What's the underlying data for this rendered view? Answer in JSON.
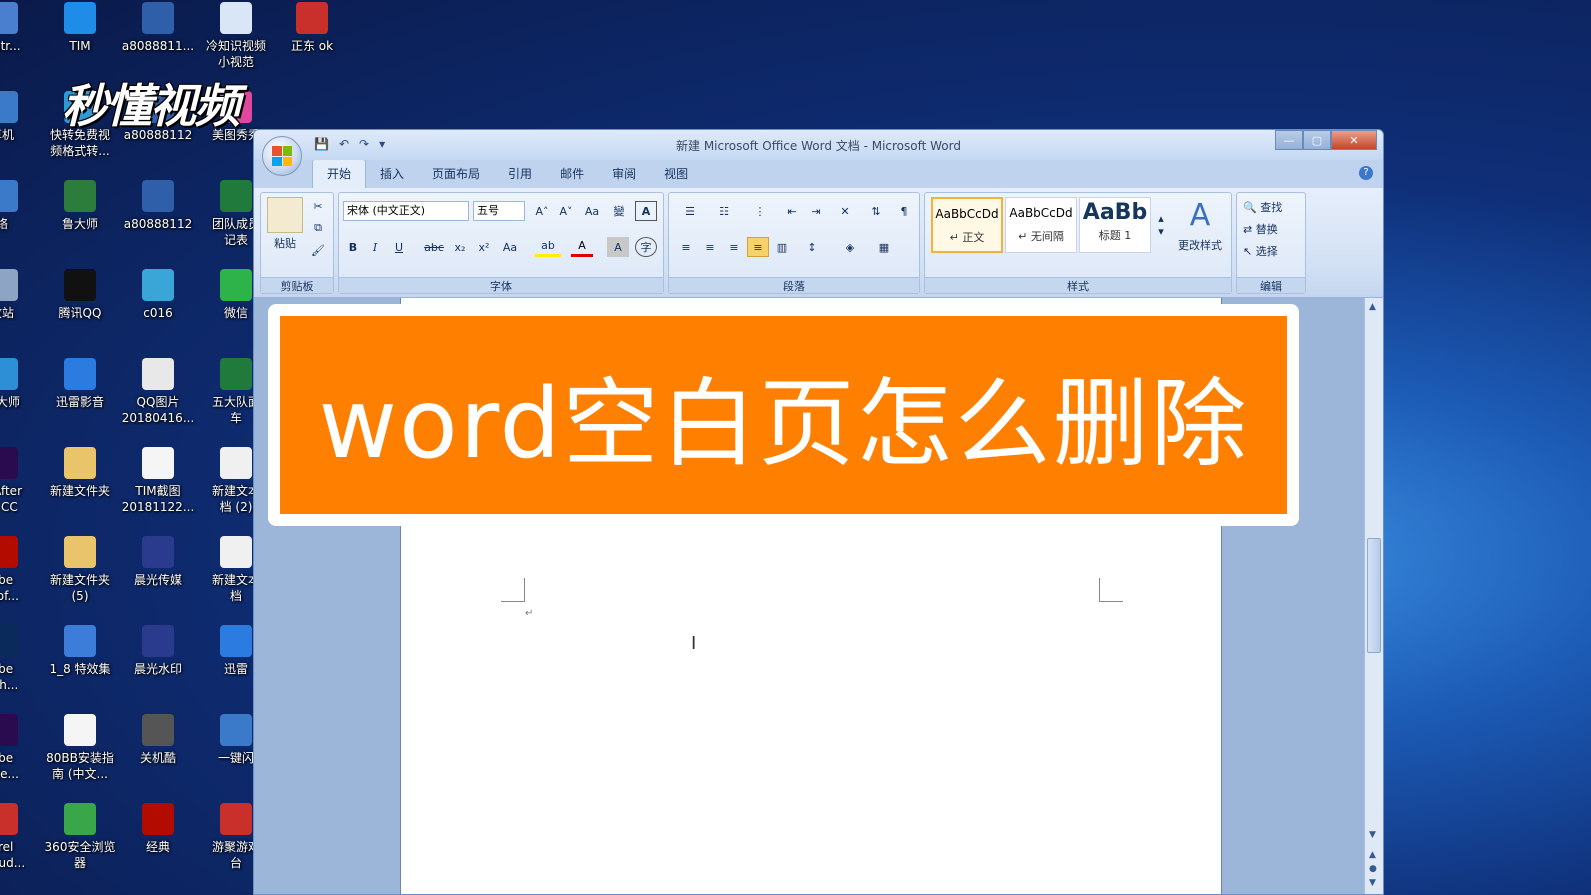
{
  "desktop": {
    "logo_text": "秒懂视频",
    "icons": [
      {
        "label": "nistr...",
        "color": "#4a7fcf"
      },
      {
        "label": "TIM",
        "color": "#1f8de8"
      },
      {
        "label": "a8088811...",
        "color": "#2f5fa8"
      },
      {
        "label": "冷知识视频\n小视范",
        "color": "#d9e6f5"
      },
      {
        "label": "正东 ok",
        "color": "#c9302c"
      },
      {
        "label": "算机",
        "color": "#3b79c9"
      },
      {
        "label": "快转免费视\n频格式转...",
        "color": "#2c9cd9"
      },
      {
        "label": "a80888112",
        "color": "#2f5fa8"
      },
      {
        "label": "美图秀秀",
        "color": "#e0479e"
      },
      {
        "label": "络",
        "color": "#3b79c9"
      },
      {
        "label": "鲁大师",
        "color": "#2c7c3c"
      },
      {
        "label": "a80888112",
        "color": "#2f5fa8"
      },
      {
        "label": "团队成员\n记表",
        "color": "#1f7a3c"
      },
      {
        "label": "收站",
        "color": "#8ea4c4"
      },
      {
        "label": "腾讯QQ",
        "color": "#111111"
      },
      {
        "label": "c016",
        "color": "#3aa6d8"
      },
      {
        "label": "微信",
        "color": "#2db34a"
      },
      {
        "label": "动大师",
        "color": "#2d8fd6"
      },
      {
        "label": "迅雷影音",
        "color": "#2b7be0"
      },
      {
        "label": "QQ图片\n20180416...",
        "color": "#e8e8e8"
      },
      {
        "label": "五大队面\n车",
        "color": "#1f7a3c"
      },
      {
        "label": "e After\nts CC",
        "color": "#2a0b4f"
      },
      {
        "label": "新建文件夹",
        "color": "#e9c46a"
      },
      {
        "label": "TIM截图\n20181122...",
        "color": "#f5f5f5"
      },
      {
        "label": "新建文本\n档 (2)",
        "color": "#f0f0f0"
      },
      {
        "label": "obe\nProf...",
        "color": "#b30b00"
      },
      {
        "label": "新建文件夹\n(5)",
        "color": "#e9c46a"
      },
      {
        "label": "晨光传媒",
        "color": "#2a3a8c"
      },
      {
        "label": "新建文本\n档",
        "color": "#f0f0f0"
      },
      {
        "label": "obe\nosh...",
        "color": "#0b2a5c"
      },
      {
        "label": "1_8 特效集",
        "color": "#3b7dd8"
      },
      {
        "label": "晨光水印",
        "color": "#2a3a8c"
      },
      {
        "label": "迅雷",
        "color": "#2b7be0"
      },
      {
        "label": "obe\nmie...",
        "color": "#2a0b4f"
      },
      {
        "label": "80BB安装指\n南 (中文...",
        "color": "#f5f5f5"
      },
      {
        "label": "关机酷",
        "color": "#555555"
      },
      {
        "label": "一键闪",
        "color": "#3b79c9"
      },
      {
        "label": "orel\noStud...",
        "color": "#c9302c"
      },
      {
        "label": "360安全浏览\n器",
        "color": "#3aa64a"
      },
      {
        "label": "经典",
        "color": "#b30b00"
      },
      {
        "label": "游聚游戏\n台",
        "color": "#c9302c"
      }
    ]
  },
  "window": {
    "title": "新建 Microsoft Office Word 文档 - Microsoft Word",
    "controls": {
      "minimize": "—",
      "maximize": "▢",
      "close": "✕"
    },
    "help": "?",
    "qat": {
      "save": "💾",
      "undo": "↶",
      "redo": "↷",
      "more": "▾"
    }
  },
  "tabs": [
    "开始",
    "插入",
    "页面布局",
    "引用",
    "邮件",
    "审阅",
    "视图"
  ],
  "ribbon": {
    "clipboard": {
      "name": "剪贴板",
      "paste": "粘贴",
      "cut": "✂",
      "copy": "⧉",
      "format_painter": "🖌"
    },
    "font": {
      "name": "字体",
      "font_family": "宋体 (中文正文)",
      "font_size": "五号",
      "grow": "A˄",
      "shrink": "A˅",
      "clear": "Aa",
      "phonetic": "變",
      "border": "A",
      "bold": "B",
      "italic": "I",
      "underline": "U",
      "strike": "abc",
      "subscript": "x₂",
      "superscript": "x²",
      "case": "Aa",
      "highlight": "ab",
      "color": "A",
      "shade": "A",
      "enclose": "字"
    },
    "paragraph": {
      "name": "段落"
    },
    "styles": {
      "name": "样式",
      "items": [
        {
          "sample": "AaBbCcDd",
          "label": "↵ 正文"
        },
        {
          "sample": "AaBbCcDd",
          "label": "↵ 无间隔"
        },
        {
          "sample": "AaBb",
          "label": "标题 1"
        }
      ],
      "change": "更改样式"
    },
    "editing": {
      "name": "编辑",
      "find": "查找",
      "replace": "替换",
      "select": "选择"
    }
  },
  "document": {
    "paragraph_mark": "↵",
    "cursor": "I"
  },
  "banner": {
    "text": "word空白页怎么删除"
  }
}
